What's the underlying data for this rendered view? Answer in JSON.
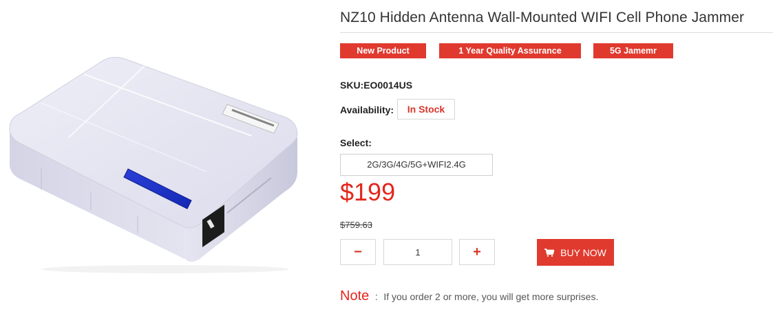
{
  "product": {
    "title": "NZ10 Hidden Antenna Wall-Mounted WIFI Cell Phone Jammer",
    "image_alt": "white wall-mounted jammer box"
  },
  "badges": [
    "New Product",
    "1 Year Quality Assurance",
    "5G Jamemr"
  ],
  "sku": "SKU:EO0014US",
  "availability": {
    "label": "Availability:",
    "value": "In Stock"
  },
  "select": {
    "label": "Select:",
    "option": "2G/3G/4G/5G+WIFI2.4G"
  },
  "pricing": {
    "price": "$199",
    "old_price": "$759.63"
  },
  "quantity": {
    "minus": "−",
    "plus": "+",
    "value": "1"
  },
  "buy_button": {
    "label": "BUY NOW",
    "icon": "cart-icon"
  },
  "note": {
    "label": "Note",
    "colon": ":",
    "text": "If you order 2 or more, you will get more surprises."
  },
  "colors": {
    "accent": "#e03a2f",
    "price": "#e3261b"
  }
}
